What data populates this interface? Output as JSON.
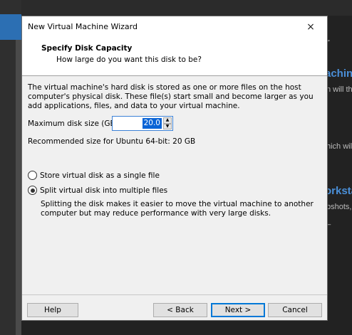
{
  "background": {
    "glyph": "r",
    "heading_1": "achin",
    "line_1": "n will the",
    "line_2": "hich will",
    "heading_2": "orksta",
    "line_3": "pshots,",
    "line_4": "_"
  },
  "dialog": {
    "title": "New Virtual Machine Wizard",
    "close_icon": "×"
  },
  "header": {
    "title": "Specify Disk Capacity",
    "subtitle": "How large do you want this disk to be?"
  },
  "body": {
    "description": "The virtual machine's hard disk is stored as one or more files on the host computer's physical disk. These file(s) start small and become larger as you add applications, files, and data to your virtual machine.",
    "size_label": "Maximum disk size (GB):",
    "size_value": "20.0",
    "recommended": "Recommended size for Ubuntu 64-bit: 20 GB"
  },
  "options": {
    "single_file": "Store virtual disk as a single file",
    "split_files": "Split virtual disk into multiple files",
    "selected": "split_files",
    "split_description": "Splitting the disk makes it easier to move the virtual machine to another computer but may reduce performance with very large disks."
  },
  "buttons": {
    "help": "Help",
    "back": "< Back",
    "next": "Next >",
    "cancel": "Cancel"
  },
  "colors": {
    "accent": "#0078d7",
    "selection": "#0a64d6",
    "link_blue": "#4a8fd8"
  }
}
